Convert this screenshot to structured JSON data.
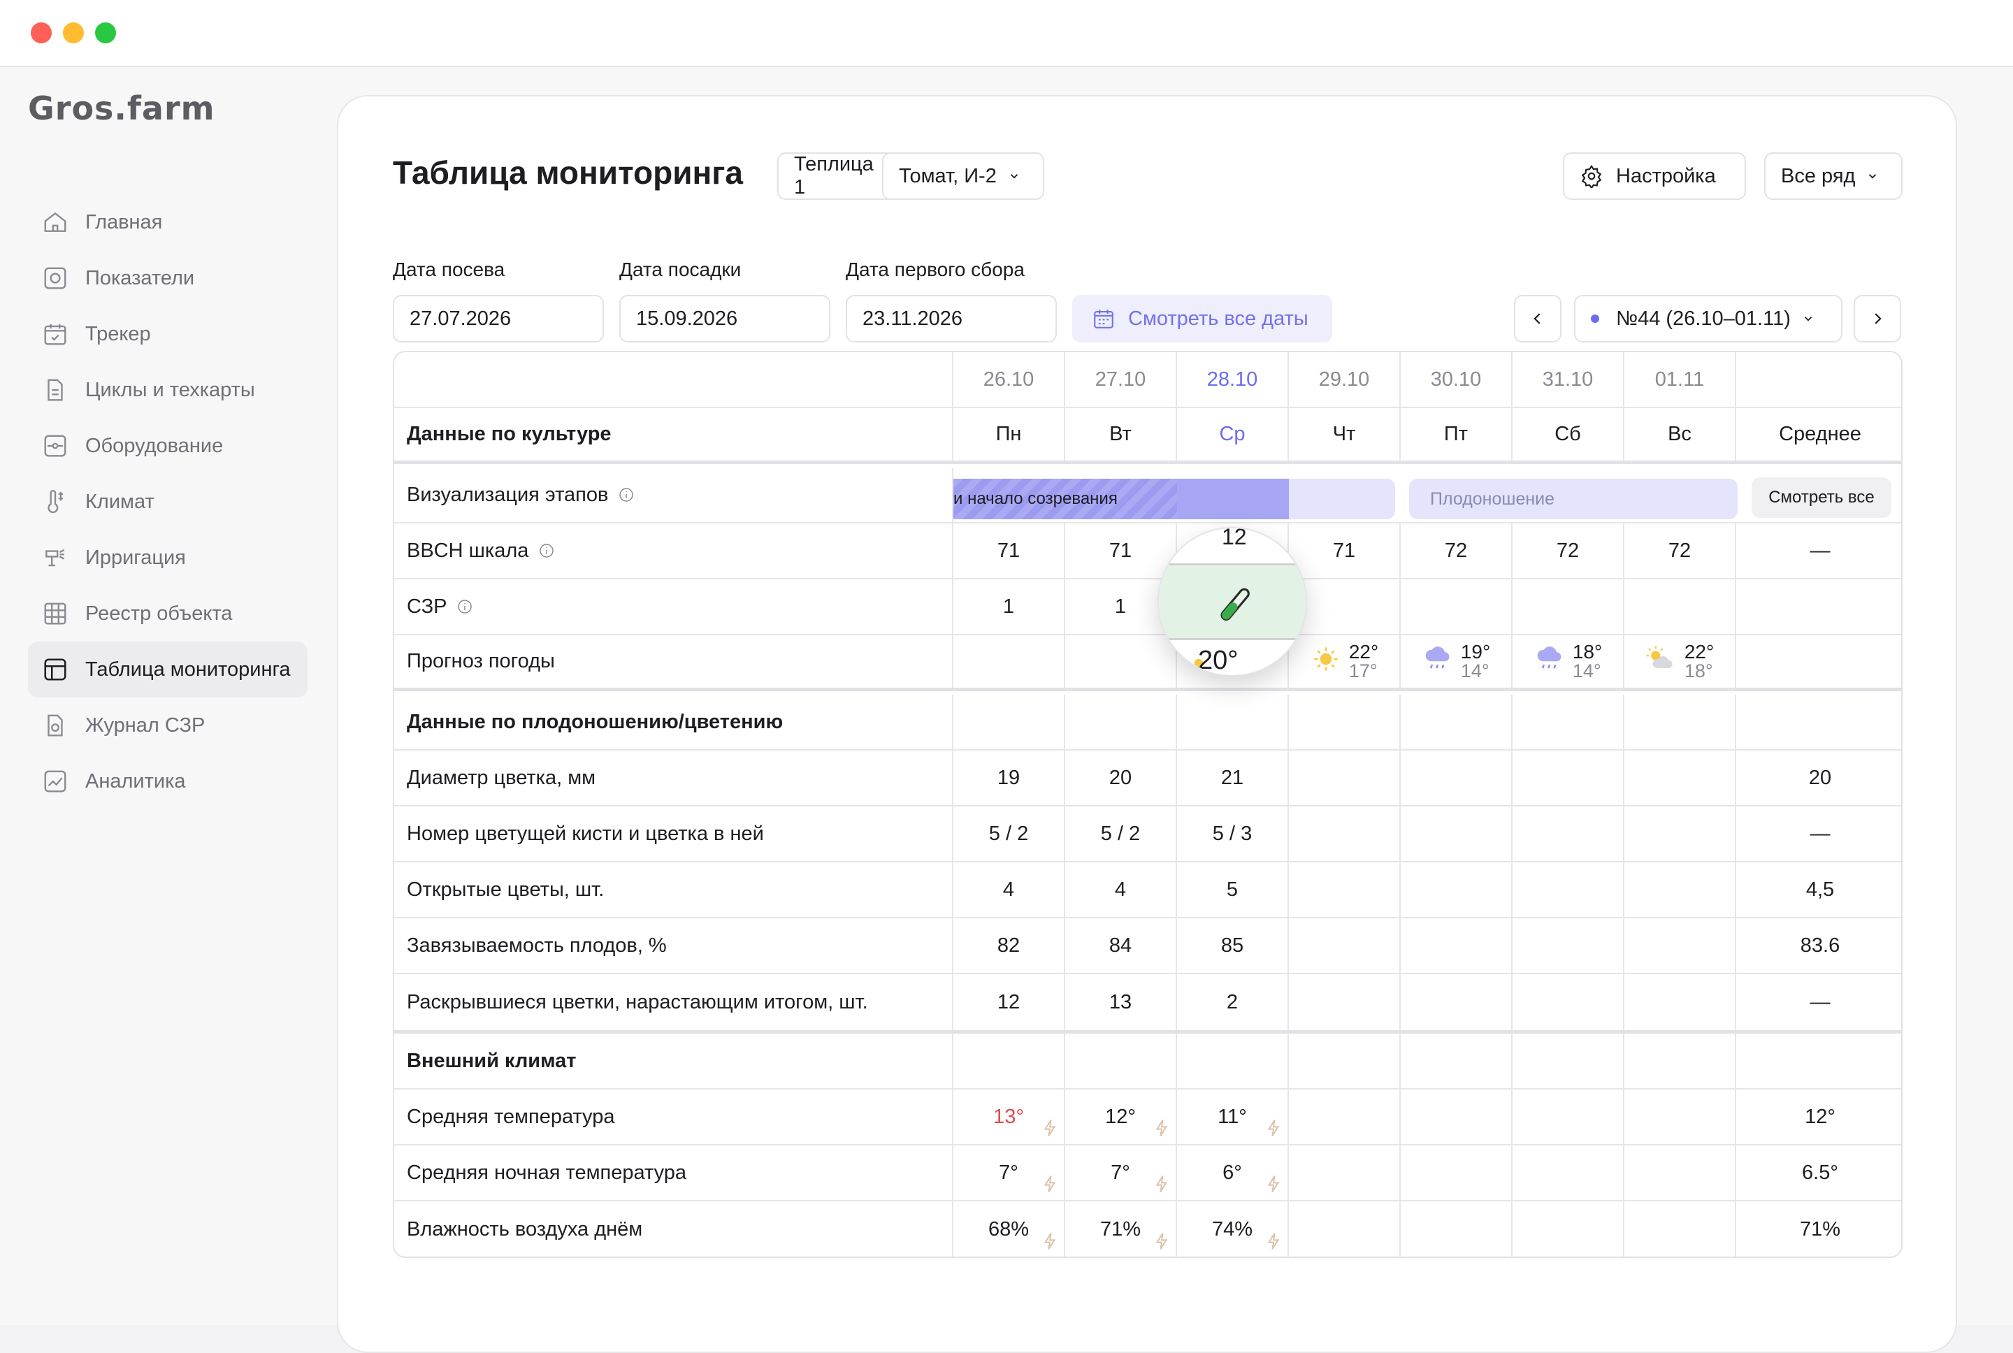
{
  "app": {
    "logo": "Gros.farm"
  },
  "sidebar": {
    "items": [
      {
        "label": "Главная",
        "icon": "home-icon"
      },
      {
        "label": "Показатели",
        "icon": "metrics-icon"
      },
      {
        "label": "Трекер",
        "icon": "calendar-check-icon"
      },
      {
        "label": "Циклы и техкарты",
        "icon": "document-icon"
      },
      {
        "label": "Оборудование",
        "icon": "equipment-icon"
      },
      {
        "label": "Климат",
        "icon": "thermometer-icon"
      },
      {
        "label": "Ирригация",
        "icon": "irrigation-icon"
      },
      {
        "label": "Реестр объекта",
        "icon": "grid-icon"
      },
      {
        "label": "Таблица мониторинга",
        "icon": "table-icon",
        "active": true
      },
      {
        "label": "Журнал СЗР",
        "icon": "journal-icon"
      },
      {
        "label": "Аналитика",
        "icon": "analytics-icon"
      }
    ]
  },
  "header": {
    "title": "Таблица мониторинга",
    "greenhouse": "Теплица 1",
    "crop": "Томат, И-2",
    "settings_label": "Настройка",
    "rows_filter": "Все ряд"
  },
  "dates": {
    "sowing_label": "Дата посева",
    "sowing_value": "27.07.2026",
    "planting_label": "Дата посадки",
    "planting_value": "15.09.2026",
    "first_harvest_label": "Дата первого сбора",
    "first_harvest_value": "23.11.2026",
    "see_all_label": "Смотреть все даты",
    "week": "№44 (26.10–01.11)"
  },
  "table": {
    "date_headers": [
      "26.10",
      "27.10",
      "28.10",
      "29.10",
      "30.10",
      "31.10",
      "01.11"
    ],
    "day_headers": [
      "Пн",
      "Вт",
      "Ср",
      "Чт",
      "Пт",
      "Сб",
      "Вс"
    ],
    "avg_header": "Среднее",
    "today_index": 2,
    "section_crop": "Данные по культуре",
    "stage_row_label": "Визуализация этапов",
    "stage_a": "и начало созревания",
    "stage_c": "Плодоношение",
    "see_all_btn": "Смотреть все",
    "bbch_label": "BBCH шкала",
    "bbch": [
      "71",
      "71",
      "",
      "71",
      "72",
      "72",
      "72"
    ],
    "bbch_avg": "—",
    "szr_label": "СЗР",
    "szr": [
      "1",
      "1",
      "",
      "",
      "",
      "",
      ""
    ],
    "weather_label": "Прогноз погоды",
    "weather": [
      {
        "hi": "",
        "lo": "",
        "icon": ""
      },
      {
        "hi": "",
        "lo": "",
        "icon": ""
      },
      {
        "hi": "",
        "lo": "",
        "icon": ""
      },
      {
        "hi": "22°",
        "lo": "17°",
        "icon": "sun-icon"
      },
      {
        "hi": "19°",
        "lo": "14°",
        "icon": "rain-cloud-icon"
      },
      {
        "hi": "18°",
        "lo": "14°",
        "icon": "rain-cloud-icon"
      },
      {
        "hi": "22°",
        "lo": "18°",
        "icon": "partly-cloudy-icon"
      }
    ],
    "section_fruit": "Данные по плодоношению/цветению",
    "fruit_rows": [
      {
        "label": "Диаметр цветка, мм",
        "values": [
          "19",
          "20",
          "21",
          "",
          "",
          "",
          ""
        ],
        "avg": "20"
      },
      {
        "label": "Номер цветущей кисти и цветка в ней",
        "values": [
          "5 / 2",
          "5 / 2",
          "5 / 3",
          "",
          "",
          "",
          ""
        ],
        "avg": "—"
      },
      {
        "label": "Открытые цветы, шт.",
        "values": [
          "4",
          "4",
          "5",
          "",
          "",
          "",
          ""
        ],
        "avg": "4,5"
      },
      {
        "label": "Завязываемость плодов, %",
        "values": [
          "82",
          "84",
          "85",
          "",
          "",
          "",
          ""
        ],
        "avg": "83.6"
      },
      {
        "label": "Раскрывшиеся цветки, нарастающим итогом, шт.",
        "values": [
          "12",
          "13",
          "2",
          "",
          "",
          "",
          ""
        ],
        "avg": "—"
      }
    ],
    "section_climate": "Внешний климат",
    "climate_rows": [
      {
        "label": "Средняя температура",
        "values": [
          "13°",
          "12°",
          "11°",
          "",
          "",
          "",
          ""
        ],
        "avg": "12°"
      },
      {
        "label": "Средняя ночная температура",
        "values": [
          "7°",
          "7°",
          "6°",
          "",
          "",
          "",
          ""
        ],
        "avg": "6.5°"
      },
      {
        "label": "Влажность воздуха днём",
        "values": [
          "68%",
          "71%",
          "74%",
          "",
          "",
          "",
          ""
        ],
        "avg": "71%"
      }
    ],
    "highlight_color": "#e04a4a"
  },
  "magnifier": {
    "top_value": "12",
    "bottom_value": "20°",
    "icon": "test-tube-icon"
  },
  "colors": {
    "accent": "#6c6cf0",
    "stage_fill": "#a6a6f5",
    "stage_light": "#e4e4fc",
    "magnifier_band": "#e2f2e4"
  }
}
